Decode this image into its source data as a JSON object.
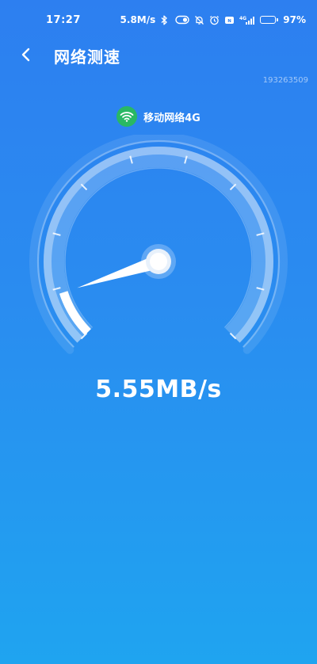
{
  "status_bar": {
    "time": "17:27",
    "net_speed": "5.8M/s",
    "network_type": "4G",
    "battery": "97%",
    "battery_level": 0.97
  },
  "header": {
    "title": "网络测速"
  },
  "device_id": "193263509",
  "network": {
    "label": "移动网络4G"
  },
  "gauge": {
    "progress": 0.1
  },
  "result": {
    "speed": "5.55MB/s"
  }
}
